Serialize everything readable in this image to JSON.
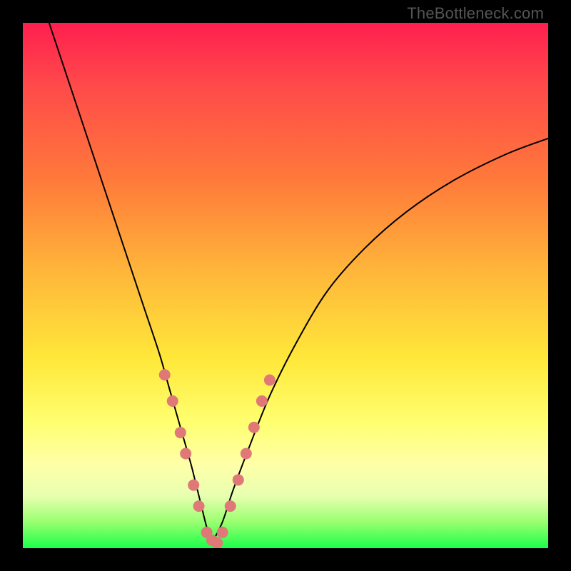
{
  "watermark": "TheBottleneck.com",
  "colors": {
    "frame": "#000000",
    "gradient_stops": [
      "#ff1f4f",
      "#ff4a4a",
      "#ff7a3a",
      "#ffb83a",
      "#ffe83a",
      "#ffff70",
      "#ffffa8",
      "#e8ffb0",
      "#9aff70",
      "#1aff4a"
    ],
    "curve": "#000000",
    "marker": "#e07878"
  },
  "chart_data": {
    "type": "line",
    "title": "",
    "xlabel": "",
    "ylabel": "",
    "xlim": [
      0,
      100
    ],
    "ylim": [
      0,
      100
    ],
    "grid": false,
    "legend": false,
    "series": [
      {
        "name": "left-curve",
        "x": [
          5,
          8,
          11,
          14,
          17,
          20,
          23,
          26,
          28,
          30,
          32,
          33,
          34,
          35,
          36
        ],
        "y": [
          100,
          91,
          82,
          73,
          64,
          55,
          46,
          37,
          30,
          23,
          16,
          12,
          8,
          4,
          1
        ]
      },
      {
        "name": "right-curve",
        "x": [
          36,
          38,
          40,
          43,
          47,
          52,
          58,
          65,
          73,
          82,
          92,
          100
        ],
        "y": [
          1,
          5,
          11,
          19,
          29,
          39,
          49,
          57,
          64,
          70,
          75,
          78
        ]
      }
    ],
    "markers": [
      {
        "series": "left-curve",
        "x": 27,
        "y": 33
      },
      {
        "series": "left-curve",
        "x": 28.5,
        "y": 28
      },
      {
        "series": "left-curve",
        "x": 30,
        "y": 22
      },
      {
        "series": "left-curve",
        "x": 31,
        "y": 18
      },
      {
        "series": "left-curve",
        "x": 32.5,
        "y": 12
      },
      {
        "series": "left-curve",
        "x": 33.5,
        "y": 8
      },
      {
        "series": "left-curve",
        "x": 35,
        "y": 3
      },
      {
        "series": "left-curve",
        "x": 36,
        "y": 1.5
      },
      {
        "series": "valley",
        "x": 37,
        "y": 1
      },
      {
        "series": "right-curve",
        "x": 38,
        "y": 3
      },
      {
        "series": "right-curve",
        "x": 39.5,
        "y": 8
      },
      {
        "series": "right-curve",
        "x": 41,
        "y": 13
      },
      {
        "series": "right-curve",
        "x": 42.5,
        "y": 18
      },
      {
        "series": "right-curve",
        "x": 44,
        "y": 23
      },
      {
        "series": "right-curve",
        "x": 45.5,
        "y": 28
      },
      {
        "series": "right-curve",
        "x": 47,
        "y": 32
      }
    ],
    "marker_radius_px": 8
  }
}
